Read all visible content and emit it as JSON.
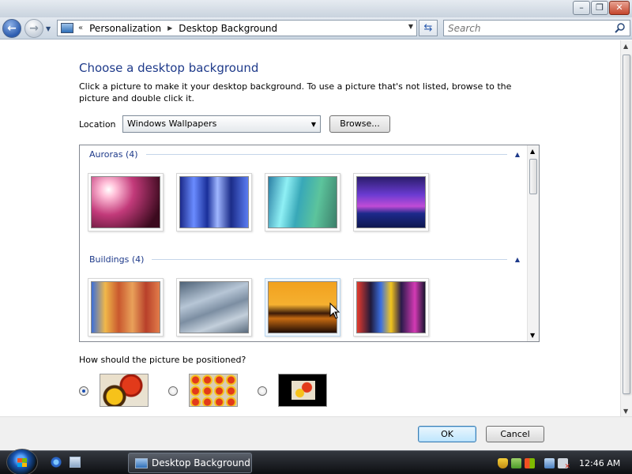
{
  "window": {
    "caption_buttons": [
      "minimize",
      "maximize",
      "close"
    ]
  },
  "nav": {
    "address": {
      "segments": [
        "Personalization",
        "Desktop Background"
      ]
    },
    "search": {
      "placeholder": "Search"
    }
  },
  "page": {
    "title": "Choose a desktop background",
    "description": "Click a picture to make it your desktop background. To use a picture that's not listed, browse to the picture and double click it.",
    "location_label": "Location",
    "location_value": "Windows Wallpapers",
    "browse_label": "Browse..."
  },
  "gallery": {
    "groups": [
      {
        "title": "Auroras (4)",
        "images": [
          "aurora-1",
          "aurora-2",
          "aurora-3",
          "aurora-4"
        ]
      },
      {
        "title": "Buildings (4)",
        "images": [
          "building-1",
          "building-2",
          "building-3",
          "building-4"
        ]
      }
    ],
    "hovered_image": "building-3"
  },
  "positioning": {
    "question": "How should the picture be positioned?",
    "options": [
      "fill",
      "tile",
      "center"
    ],
    "selected": "fill"
  },
  "buttons": {
    "ok": "OK",
    "cancel": "Cancel"
  },
  "taskbar": {
    "item_label": "Desktop Background",
    "clock": "12:46 AM"
  },
  "colors": {
    "title_text": "#1e3a8a",
    "taskbar": "#1a1d22",
    "ok_button": "#bee6fd"
  }
}
